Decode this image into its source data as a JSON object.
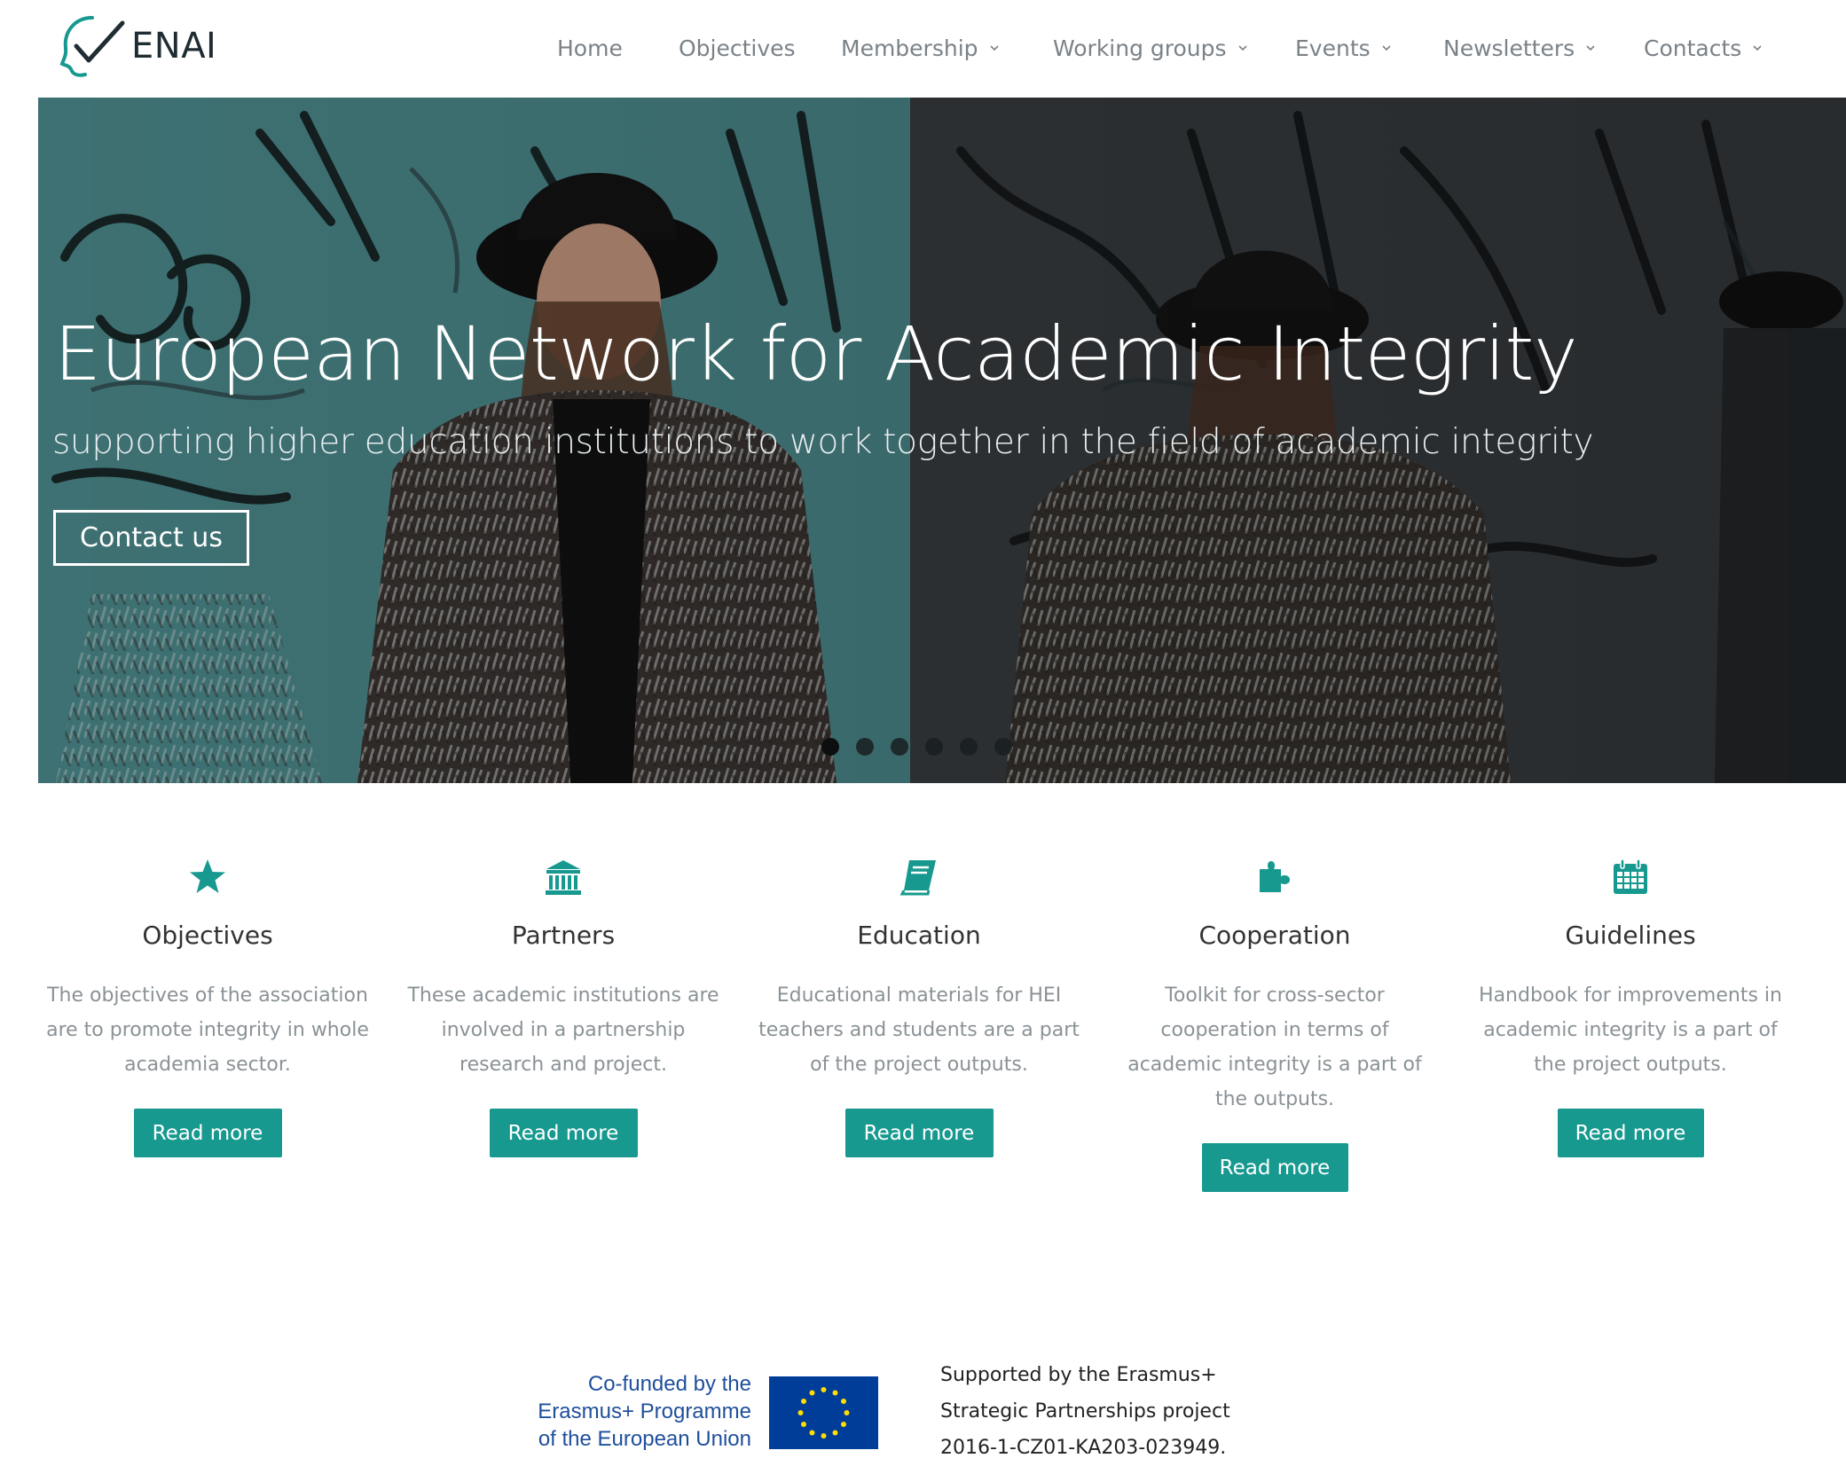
{
  "brand": {
    "name": "ENAI"
  },
  "nav": {
    "items": [
      {
        "label": "Home",
        "dropdown": false
      },
      {
        "label": "Objectives",
        "dropdown": false
      },
      {
        "label": "Membership",
        "dropdown": true
      },
      {
        "label": "Working groups",
        "dropdown": true
      },
      {
        "label": "Events",
        "dropdown": true
      },
      {
        "label": "Newsletters",
        "dropdown": true
      },
      {
        "label": "Contacts",
        "dropdown": true
      }
    ]
  },
  "hero": {
    "title": "European Network for Academic Integrity",
    "subtitle": "supporting higher education institutions to work together in the field of academic integrity",
    "cta_label": "Contact us",
    "slides": 6,
    "active_slide": 1
  },
  "features": [
    {
      "icon": "star-icon",
      "title": "Objectives",
      "text": "The objectives of the association are to promote integrity in whole academia sector.",
      "button": "Read more"
    },
    {
      "icon": "institution-icon",
      "title": "Partners",
      "text": "These academic institutions are involved in a partnership research and project.",
      "button": "Read more"
    },
    {
      "icon": "book-icon",
      "title": "Education",
      "text": "Educational materials for HEI teachers and students are a part of the project outputs.",
      "button": "Read more"
    },
    {
      "icon": "puzzle-icon",
      "title": "Cooperation",
      "text": "Toolkit for cross-sector cooperation in terms of academic integrity is a part of the outputs.",
      "button": "Read more"
    },
    {
      "icon": "calendar-icon",
      "title": "Guidelines",
      "text": "Handbook for improvements in academic integrity is a part of the project outputs.",
      "button": "Read more"
    }
  ],
  "footer": {
    "eu_lines": [
      "Co-funded by the",
      "Erasmus+ Programme",
      "of the European Union"
    ],
    "support_lines": [
      "Supported by the Erasmus+",
      "Strategic Partnerships project",
      "2016-1-CZ01-KA203-023949."
    ]
  },
  "colors": {
    "accent": "#17998f",
    "text": "#333333",
    "muted": "#8a9296",
    "eu_blue": "#003d99",
    "eu_text": "#1f4f9c"
  }
}
